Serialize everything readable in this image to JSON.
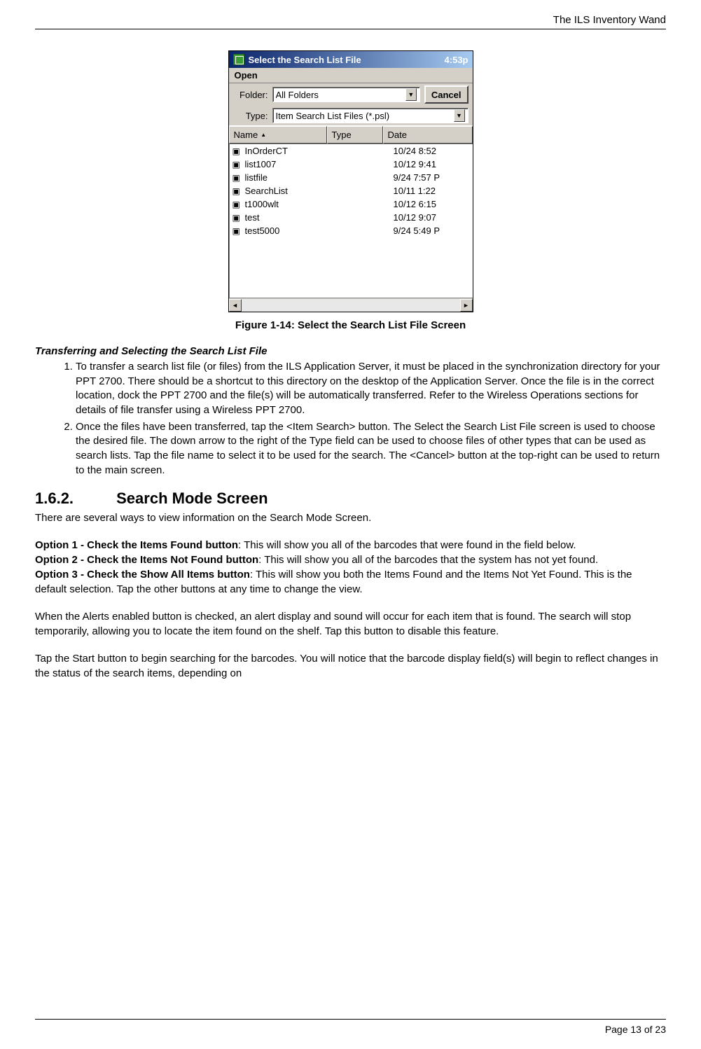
{
  "header": {
    "title": "The ILS Inventory Wand"
  },
  "window": {
    "title": "Select the Search List File",
    "time": "4:53p",
    "menu_open": "Open",
    "folder_label": "Folder:",
    "folder_value": "All Folders",
    "type_label": "Type:",
    "type_value": "Item Search List Files (*.psl)",
    "cancel": "Cancel",
    "col_name": "Name",
    "col_type": "Type",
    "col_date": "Date",
    "rows": [
      {
        "name": "InOrderCT",
        "date": "10/24 8:52"
      },
      {
        "name": "list1007",
        "date": "10/12 9:41"
      },
      {
        "name": "listfile",
        "date": "9/24 7:57 P"
      },
      {
        "name": "SearchList",
        "date": "10/11 1:22"
      },
      {
        "name": "t1000wlt",
        "date": "10/12 6:15"
      },
      {
        "name": "test",
        "date": "10/12 9:07"
      },
      {
        "name": "test5000",
        "date": "9/24 5:49 P"
      }
    ]
  },
  "figure_caption": "Figure 1-14: Select the Search List File Screen",
  "transfer_heading": "Transferring and Selecting the Search List File",
  "steps": [
    "To transfer a search list file (or files) from the ILS Application Server, it must be placed in the synchronization directory for your PPT 2700. There should be a shortcut to this directory on the desktop of the Application Server. Once the file is in the correct location, dock the PPT 2700 and the file(s) will be automatically transferred. Refer to the Wireless Operations sections for details of file transfer using a Wireless PPT 2700.",
    "Once the files have been transferred, tap the <Item Search> button. The Select the Search List File screen is used to choose the desired file. The down arrow to the right of the Type field can be used to choose files of other types that can be used as search lists. Tap the file name to select it to be used for the search. The <Cancel> button at the top-right can be used to return to the main screen."
  ],
  "section": {
    "num": "1.6.2.",
    "title": "Search Mode Screen"
  },
  "intro": "There are several ways to view information on the Search Mode Screen.",
  "options": [
    {
      "label": "Option 1 - Check the Items Found button",
      "text": ": This will show you all of the barcodes that were found in the field below."
    },
    {
      "label": "Option 2 - Check the Items Not Found button",
      "text": ": This will show you all of the barcodes that the system has not yet found."
    },
    {
      "label": "Option 3 - Check the Show All Items button",
      "text": ": This will show you both the Items Found and the Items Not Yet Found. This is the default selection. Tap the other buttons at any time to change the view."
    }
  ],
  "alerts": "When the Alerts enabled button is checked, an alert display and sound will occur for each item that is found. The search will stop temporarily, allowing you to locate the item found on the shelf. Tap this button to disable this feature.",
  "start": "Tap the Start button to begin searching for the barcodes.  You will notice that the barcode display field(s) will begin to reflect changes in the status of the search items, depending on",
  "footer": "Page 13 of 23"
}
